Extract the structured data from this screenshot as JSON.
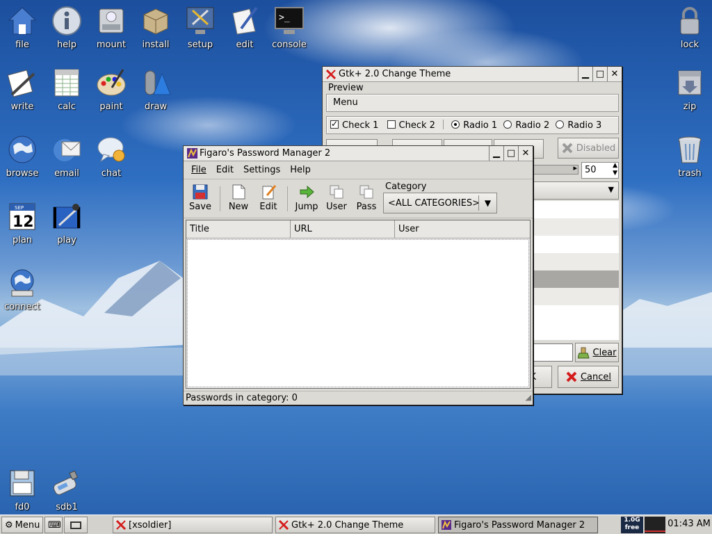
{
  "desktop": {
    "icons_left": [
      {
        "label": "file",
        "icon": "home-folder-icon"
      },
      {
        "label": "help",
        "icon": "info-icon"
      },
      {
        "label": "mount",
        "icon": "drive-icon"
      },
      {
        "label": "install",
        "icon": "package-icon"
      },
      {
        "label": "setup",
        "icon": "tools-monitor-icon"
      },
      {
        "label": "edit",
        "icon": "pen-paper-icon"
      },
      {
        "label": "console",
        "icon": "terminal-icon"
      },
      {
        "label": "write",
        "icon": "write-icon"
      },
      {
        "label": "calc",
        "icon": "spreadsheet-icon"
      },
      {
        "label": "paint",
        "icon": "palette-icon"
      },
      {
        "label": "draw",
        "icon": "draw-icon"
      },
      {
        "label": "browse",
        "icon": "globe-icon"
      },
      {
        "label": "email",
        "icon": "email-icon"
      },
      {
        "label": "chat",
        "icon": "chat-icon"
      },
      {
        "label": "plan",
        "icon": "calendar-icon"
      },
      {
        "label": "play",
        "icon": "media-play-icon"
      },
      {
        "label": "connect",
        "icon": "connect-globe-icon"
      },
      {
        "label": "fd0",
        "icon": "floppy-icon"
      },
      {
        "label": "sdb1",
        "icon": "usb-drive-icon"
      }
    ],
    "icons_right": [
      {
        "label": "lock",
        "icon": "padlock-icon"
      },
      {
        "label": "zip",
        "icon": "zip-icon"
      },
      {
        "label": "trash",
        "icon": "trash-icon"
      }
    ],
    "calendar_day": "12",
    "calendar_month": "SEP",
    "console_prompt": ">_"
  },
  "theme_window": {
    "title": "Gtk+ 2.0 Change Theme",
    "preview_label": "Preview",
    "menu_label": "Menu",
    "check1": "Check 1",
    "check2": "Check 2",
    "radio1": "Radio 1",
    "radio2": "Radio 2",
    "radio3": "Radio 3",
    "disabled_label": "Disabled",
    "spin_value": "50",
    "clear_label": "Clear",
    "cancel_label": "Cancel",
    "ok_fragment": "K"
  },
  "figaro_window": {
    "title": "Figaro's Password Manager 2",
    "menu": {
      "file": "File",
      "edit": "Edit",
      "settings": "Settings",
      "help": "Help"
    },
    "toolbar": {
      "save": "Save",
      "new": "New",
      "edit": "Edit",
      "jump": "Jump",
      "user": "User",
      "pass": "Pass"
    },
    "category_label": "Category",
    "category_value": "<ALL CATEGORIES>",
    "columns": [
      "Title",
      "URL",
      "User"
    ],
    "status": "Passwords in category: 0"
  },
  "taskbar": {
    "menu_label": "Menu",
    "tasks": [
      {
        "label": "[xsoldier]"
      },
      {
        "label": "Gtk+ 2.0 Change Theme"
      },
      {
        "label": "Figaro's Password Manager 2"
      }
    ],
    "disk_free_top": "1.0G",
    "disk_free_bottom": "free",
    "clock": "01:43 AM"
  },
  "colors": {
    "taskbar_bg": "#d4d2cd",
    "window_bg": "#dcdad5",
    "x_red": "#d41c1c"
  }
}
